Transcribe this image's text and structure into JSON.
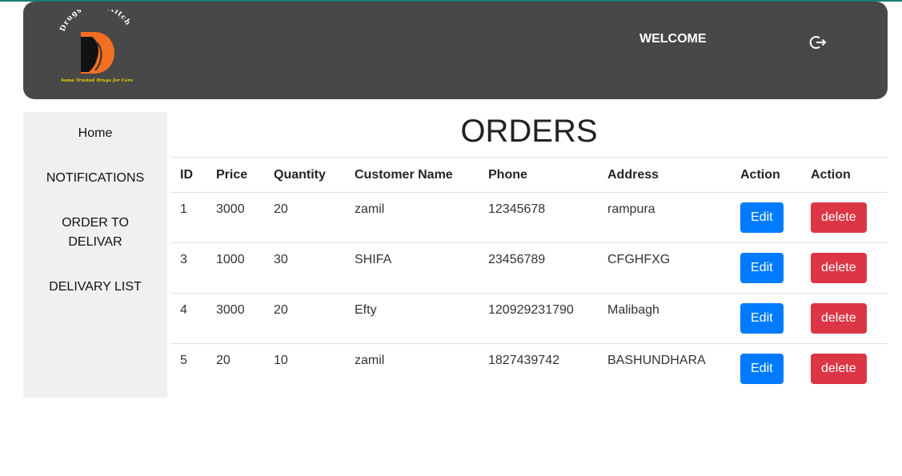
{
  "header": {
    "logo_text": "Drugs and stitch",
    "logo_tagline": "Some Trusted Drugs for Care",
    "welcome": "WELCOME",
    "logout_icon": "logout-icon"
  },
  "sidebar": {
    "items": [
      {
        "label": "Home"
      },
      {
        "label": "NOTIFICATIONS"
      },
      {
        "label": "ORDER TO DELIVAR"
      },
      {
        "label": "DELIVARY LIST"
      }
    ]
  },
  "main": {
    "title": "ORDERS",
    "columns": [
      "ID",
      "Price",
      "Quantity",
      "Customer Name",
      "Phone",
      "Address",
      "Action",
      "Action"
    ],
    "rows": [
      {
        "id": "1",
        "price": "3000",
        "quantity": "20",
        "customer": "zamil",
        "phone": "12345678",
        "address": "rampura",
        "edit": "Edit",
        "delete": "delete"
      },
      {
        "id": "3",
        "price": "1000",
        "quantity": "30",
        "customer": "SHIFA",
        "phone": "23456789",
        "address": "CFGHFXG",
        "edit": "Edit",
        "delete": "delete"
      },
      {
        "id": "4",
        "price": "3000",
        "quantity": "20",
        "customer": "Efty",
        "phone": "120929231790",
        "address": "Malibagh",
        "edit": "Edit",
        "delete": "delete"
      },
      {
        "id": "5",
        "price": "20",
        "quantity": "10",
        "customer": "zamil",
        "phone": "1827439742",
        "address": "BASHUNDHARA",
        "edit": "Edit",
        "delete": "delete"
      }
    ]
  },
  "colors": {
    "header_bg": "#484848",
    "sidebar_bg": "#f0f0f0",
    "edit_button": "#007bff",
    "delete_button": "#dc3545",
    "logo_orange": "#f36f21"
  }
}
